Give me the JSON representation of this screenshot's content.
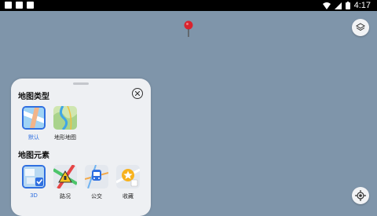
{
  "status_bar": {
    "time": "4:17"
  },
  "panel": {
    "map_type": {
      "title": "地图类型",
      "options": [
        {
          "label": "默认",
          "icon": "default-map-icon",
          "selected": true
        },
        {
          "label": "地形地图",
          "icon": "terrain-map-icon",
          "selected": false
        }
      ]
    },
    "map_elements": {
      "title": "地图元素",
      "options": [
        {
          "label": "3D",
          "icon": "3d-map-icon",
          "selected": true
        },
        {
          "label": "路况",
          "icon": "traffic-icon",
          "selected": false
        },
        {
          "label": "公交",
          "icon": "transit-icon",
          "selected": false
        },
        {
          "label": "收藏",
          "icon": "favorites-icon",
          "selected": false
        }
      ]
    }
  },
  "colors": {
    "accent": "#2f6fe0",
    "map_background": "#7f95aa",
    "pin": "#d9232e"
  }
}
